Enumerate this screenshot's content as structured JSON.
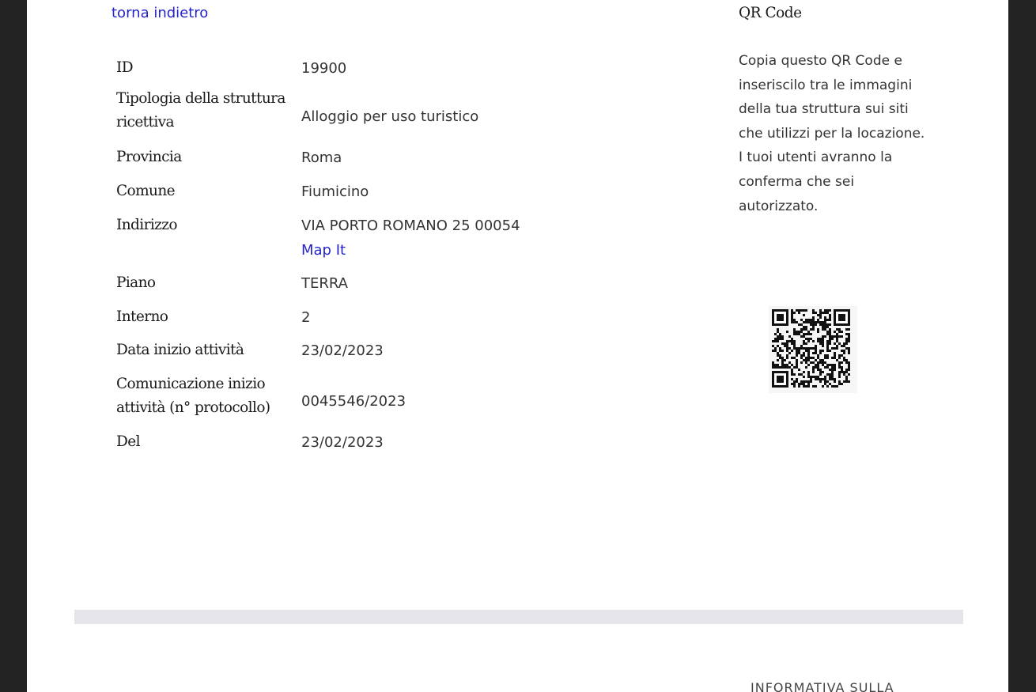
{
  "back_link": "torna indietro",
  "details": [
    {
      "label": "ID",
      "value": "19900"
    },
    {
      "label": "Tipologia della struttura ricettiva",
      "value": "Alloggio per uso turistico"
    },
    {
      "label": "Provincia",
      "value": "Roma"
    },
    {
      "label": "Comune",
      "value": "Fiumicino"
    },
    {
      "label": "Indirizzo",
      "value": "VIA PORTO ROMANO 25 00054",
      "link": "Map It"
    },
    {
      "label": "Piano",
      "value": "TERRA"
    },
    {
      "label": "Interno",
      "value": "2"
    },
    {
      "label": "Data inizio attività",
      "value": "23/02/2023"
    },
    {
      "label": "Comunicazione inizio attività (n° protocollo)",
      "value": "0045546/2023"
    },
    {
      "label": "Del",
      "value": "23/02/2023"
    }
  ],
  "qr": {
    "title": "QR Code",
    "description": "Copia questo QR Code e inseriscilo tra le immagini della tua struttura sui siti che utilizzi per la locazione. I tuoi utenti avranno la conferma che sei autorizzato.",
    "icon": "qr-code-image"
  },
  "footer": {
    "text": "INFORMATIVA SULLA"
  },
  "colors": {
    "link": "#2424c8",
    "outer_background": "#232323",
    "separator": "#e6e6ea"
  }
}
